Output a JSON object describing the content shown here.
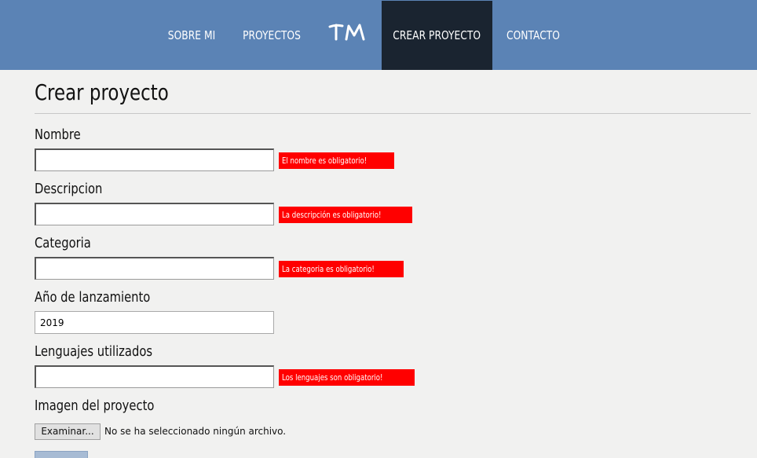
{
  "nav": {
    "items": [
      {
        "label": "SOBRE MI"
      },
      {
        "label": "PROYECTOS"
      },
      {
        "label": "CREAR PROYECTO",
        "active": true
      },
      {
        "label": "CONTACTO"
      }
    ],
    "logo_text": "TM"
  },
  "page": {
    "title": "Crear proyecto"
  },
  "form": {
    "fields": [
      {
        "label": "Nombre",
        "value": "",
        "error": "El nombre es obligatorio!"
      },
      {
        "label": "Descripcion",
        "value": "",
        "error": "La descripción es obligatorio!"
      },
      {
        "label": "Categoria",
        "value": "",
        "error": "La categoria es obligatorio!"
      },
      {
        "label": "Año de lanzamiento",
        "value": "2019",
        "error": ""
      },
      {
        "label": "Lenguajes utilizados",
        "value": "",
        "error": "Los lenguajes son obligatorio!"
      }
    ],
    "image": {
      "label": "Imagen del proyecto",
      "button_label": "Examinar...",
      "status": "No se ha seleccionado ningún archivo."
    },
    "submit_label": ""
  },
  "colors": {
    "navbar": "#5b83b5",
    "nav_active": "#1a2430",
    "error": "#ff0000",
    "background": "#f1f1f0"
  }
}
